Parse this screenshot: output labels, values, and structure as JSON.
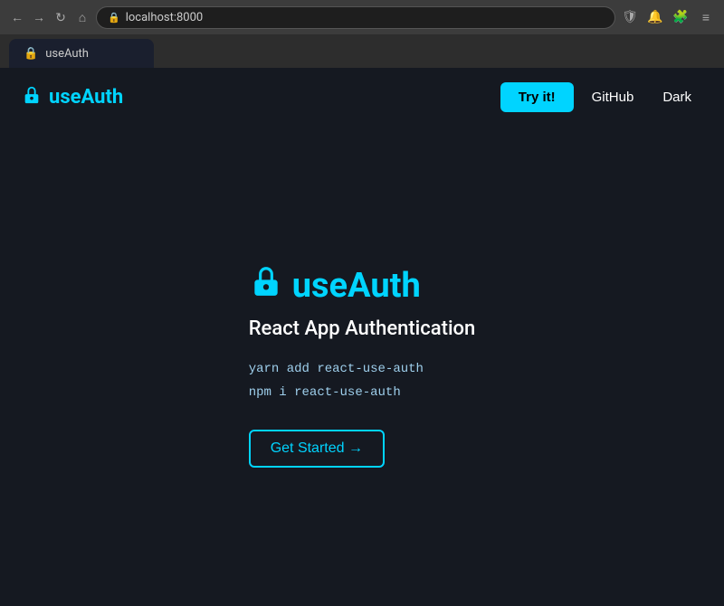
{
  "browser": {
    "url": "localhost:8000",
    "tab_title": "useAuth"
  },
  "navbar": {
    "logo_text": "useAuth",
    "try_it_label": "Try it!",
    "github_label": "GitHub",
    "dark_label": "Dark"
  },
  "hero": {
    "title": "useAuth",
    "subtitle": "React App Authentication",
    "code_line1": "yarn add react-use-auth",
    "code_line2": "npm i react-use-auth",
    "get_started_label": "Get Started →"
  },
  "colors": {
    "accent": "#00d4ff",
    "bg": "#151921",
    "text": "#ffffff",
    "code": "#9ecfec"
  }
}
